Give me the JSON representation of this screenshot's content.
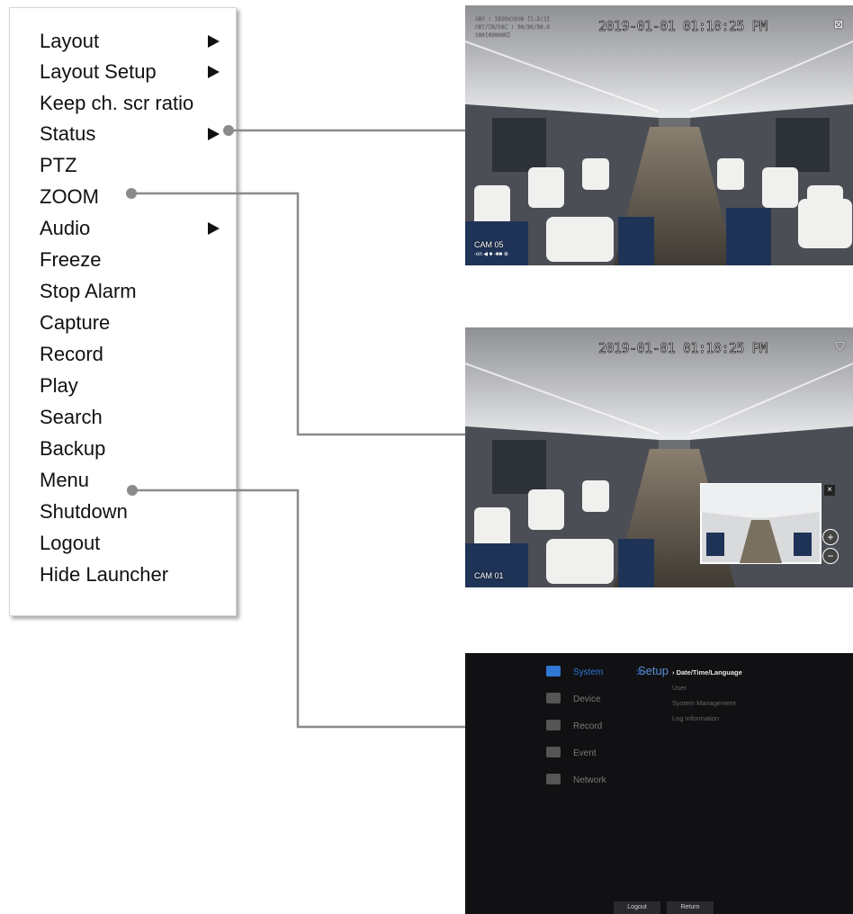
{
  "menu": {
    "items": [
      {
        "label": "Layout",
        "submenu": true
      },
      {
        "label": "Layout Setup",
        "submenu": true
      },
      {
        "label": "Keep ch. scr ratio",
        "submenu": false
      },
      {
        "label": "Status",
        "submenu": true
      },
      {
        "label": "PTZ",
        "submenu": false
      },
      {
        "label": "ZOOM",
        "submenu": false
      },
      {
        "label": "Audio",
        "submenu": true
      },
      {
        "label": "Freeze",
        "submenu": false
      },
      {
        "label": "Stop Alarm",
        "submenu": false
      },
      {
        "label": "Capture",
        "submenu": false
      },
      {
        "label": "Record",
        "submenu": false
      },
      {
        "label": "Play",
        "submenu": false
      },
      {
        "label": "Search",
        "submenu": false
      },
      {
        "label": "Backup",
        "submenu": false
      },
      {
        "label": "Menu",
        "submenu": false
      },
      {
        "label": "Shutdown",
        "submenu": false
      },
      {
        "label": "Logout",
        "submenu": false
      },
      {
        "label": "Hide Launcher",
        "submenu": false
      }
    ]
  },
  "status_panel": {
    "timestamp": "2019-01-01 01:10:25 PM",
    "osd_line1": "RES : 1920x1080 (1.2:1)",
    "osd_line2": "SET/IN/DEC : 30/30/30.0",
    "osd_line3": "100(40000K)",
    "camera": "CAM 05",
    "status_icons": "-on ◀ ■ -■■ ⊕"
  },
  "zoom_panel": {
    "timestamp": "2019-01-01 01:10:25 PM",
    "camera": "CAM 01",
    "close_symbol": "×",
    "zoom_in_symbol": "+",
    "zoom_out_symbol": "−"
  },
  "setup_panel": {
    "title": "Setup",
    "chevron": ">",
    "categories": [
      "System",
      "Device",
      "Record",
      "Event",
      "Network"
    ],
    "subitems": [
      "› Date/Time/Language",
      "User",
      "System Management",
      "Log Information"
    ],
    "buttons": {
      "logout": "Logout",
      "return": "Return"
    }
  },
  "colors": {
    "connector": "#8a8a8a",
    "setup_accent": "#2f78d6",
    "setup_background": "#111114"
  }
}
